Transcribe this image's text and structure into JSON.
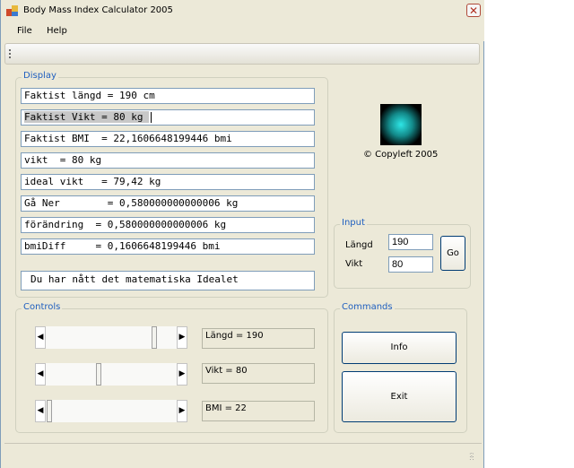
{
  "window": {
    "title": "Body Mass Index Calculator 2005"
  },
  "menu": {
    "file": "File",
    "help": "Help"
  },
  "display": {
    "legend": "Display",
    "lines": [
      "Faktist längd = 190 cm",
      "Faktist Vikt = 80 kg ",
      "Faktist BMI  = 22,1606648199446 bmi",
      "vikt  = 80 kg",
      "ideal vikt   = 79,42 kg",
      "Gå Ner        = 0,580000000000006 kg",
      "förändring  = 0,580000000000006 kg",
      "bmiDiff     = 0,1606648199446 bmi"
    ],
    "message": "Du har nått det matematiska Idealet"
  },
  "logo": {
    "copyleft": "© Copyleft 2005",
    "colors": {
      "center": "#2ee6e6",
      "edge": "#000000"
    }
  },
  "input": {
    "legend": "Input",
    "length_label": "Längd",
    "length_value": "190",
    "weight_label": "Vikt",
    "weight_value": "80",
    "go_label": "Go"
  },
  "controls": {
    "legend": "Controls",
    "sliders": [
      {
        "label": "Längd = 190",
        "position": 0.84
      },
      {
        "label": "Vikt = 80",
        "position": 0.4
      },
      {
        "label": "BMI =  22",
        "position": 0.01
      }
    ]
  },
  "commands": {
    "legend": "Commands",
    "info_label": "Info",
    "exit_label": "Exit"
  },
  "colors": {
    "accent": "#1f5fbf",
    "window_bg": "#ece9d8",
    "border": "#7f9db9"
  }
}
